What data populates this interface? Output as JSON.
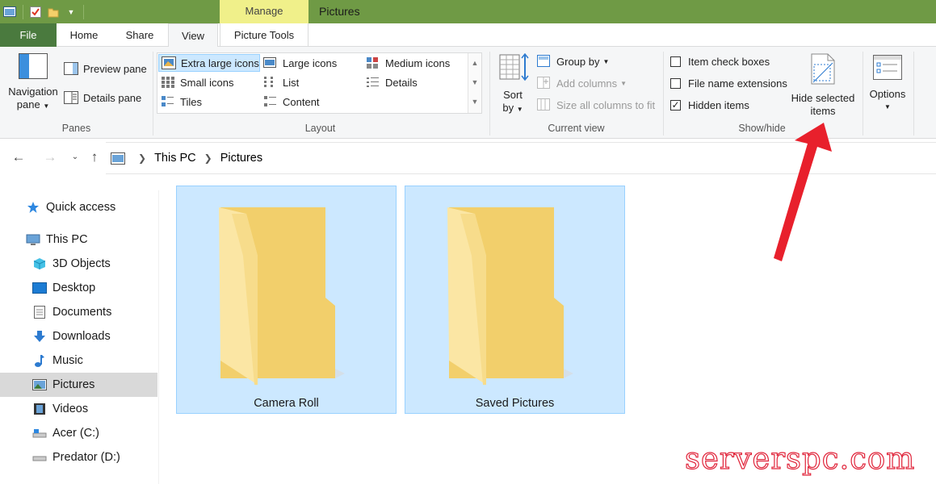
{
  "titlebar": {
    "contextual_tab": "Manage",
    "window_title": "Pictures"
  },
  "tabs": {
    "file": "File",
    "home": "Home",
    "share": "Share",
    "view": "View",
    "picture_tools": "Picture Tools"
  },
  "ribbon": {
    "panes": {
      "navigation_pane_1": "Navigation",
      "navigation_pane_2": "pane",
      "preview_pane": "Preview pane",
      "details_pane": "Details pane",
      "label": "Panes"
    },
    "layout": {
      "items": [
        "Extra large icons",
        "Large icons",
        "Medium icons",
        "Small icons",
        "List",
        "Details",
        "Tiles",
        "Content"
      ],
      "selected": "Extra large icons",
      "label": "Layout"
    },
    "current_view": {
      "sort_1": "Sort",
      "sort_2": "by",
      "group_by": "Group by",
      "add_columns": "Add columns",
      "size_columns": "Size all columns to fit",
      "label": "Current view"
    },
    "show_hide": {
      "item_check_boxes": "Item check boxes",
      "file_name_extensions": "File name extensions",
      "hidden_items": "Hidden items",
      "item_check_boxes_checked": false,
      "file_name_extensions_checked": false,
      "hidden_items_checked": true,
      "hide_selected_1": "Hide selected",
      "hide_selected_2": "items",
      "label": "Show/hide"
    },
    "options": "Options"
  },
  "address": {
    "crumbs": [
      "This PC",
      "Pictures"
    ]
  },
  "sidebar": {
    "items": [
      {
        "label": "Quick access",
        "icon": "star-icon"
      },
      {
        "label": "This PC",
        "icon": "computer-icon"
      },
      {
        "label": "3D Objects",
        "icon": "cube-icon"
      },
      {
        "label": "Desktop",
        "icon": "desktop-icon"
      },
      {
        "label": "Documents",
        "icon": "document-icon"
      },
      {
        "label": "Downloads",
        "icon": "download-icon"
      },
      {
        "label": "Music",
        "icon": "music-note-icon"
      },
      {
        "label": "Pictures",
        "icon": "picture-icon"
      },
      {
        "label": "Videos",
        "icon": "film-icon"
      },
      {
        "label": "Acer (C:)",
        "icon": "drive-icon"
      },
      {
        "label": "Predator (D:)",
        "icon": "drive-icon"
      }
    ],
    "selected": "Pictures"
  },
  "content": {
    "folders": [
      "Camera Roll",
      "Saved Pictures"
    ]
  },
  "watermark": "serverspc.com",
  "colors": {
    "titlebar": "#6f9a45",
    "file_tab": "#4a7a3e",
    "manage_tab": "#f0f08a",
    "selection_fill": "#cce8ff",
    "selection_border": "#99d1ff",
    "arrow": "#e8202c"
  }
}
